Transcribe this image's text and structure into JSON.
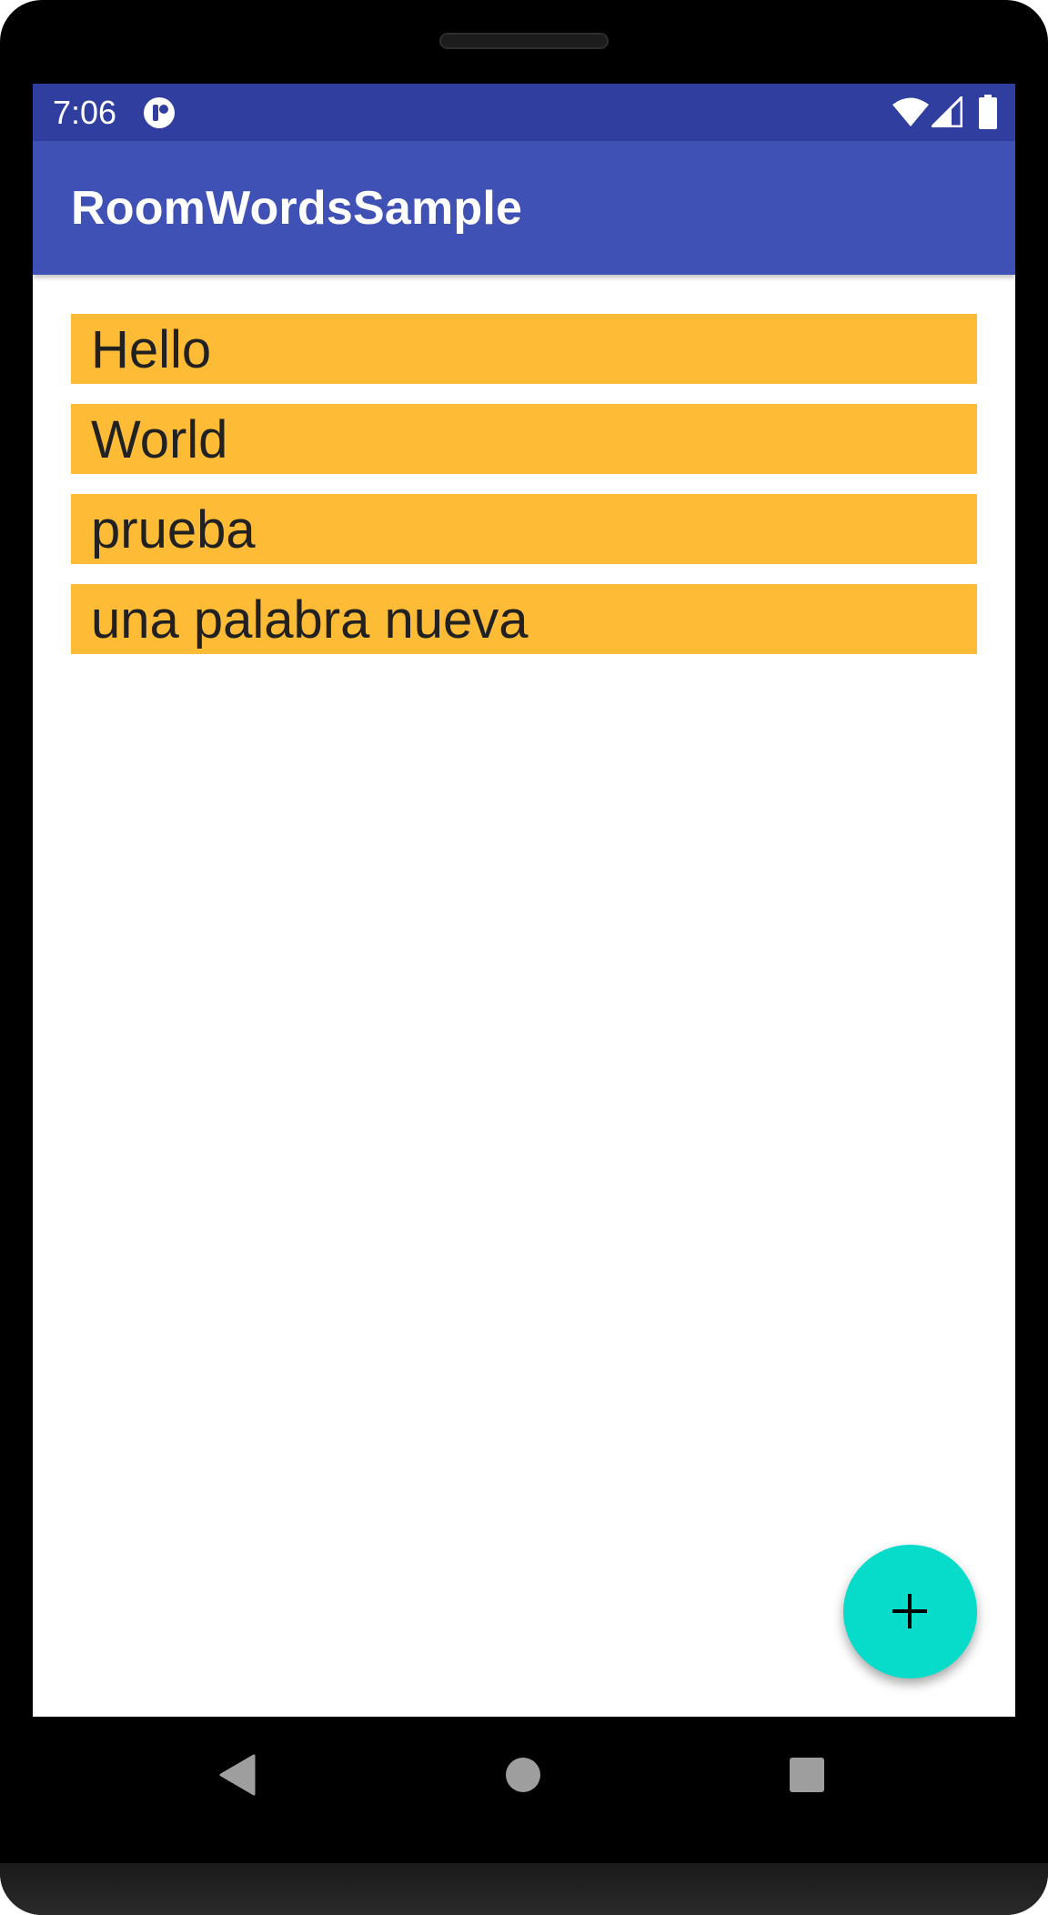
{
  "status_bar": {
    "time": "7:06",
    "icons": [
      "app-notification-icon",
      "wifi-icon",
      "cell-signal-icon",
      "battery-icon"
    ]
  },
  "app_bar": {
    "title": "RoomWordsSample"
  },
  "words": [
    "Hello",
    "World",
    "prueba",
    "una palabra nueva"
  ],
  "fab": {
    "icon": "plus-icon"
  },
  "navigation": {
    "icons": [
      "back-icon",
      "home-icon",
      "recents-icon"
    ]
  },
  "colors": {
    "status_bar": "#303f9f",
    "app_bar": "#3f51b5",
    "word_item_bg": "#fdbb36",
    "word_text": "#212121",
    "fab": "#07dbc9"
  }
}
